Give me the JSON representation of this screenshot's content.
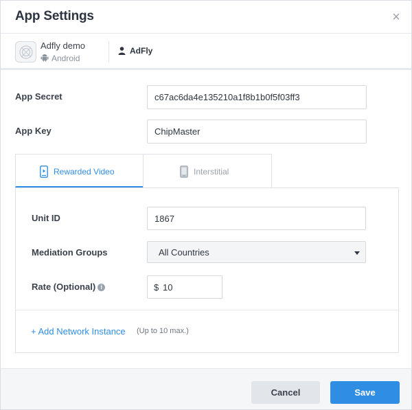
{
  "modal": {
    "title": "App Settings",
    "close_symbol": "×"
  },
  "app": {
    "name": "Adfly demo",
    "platform": "Android",
    "owner": "AdFly"
  },
  "fields": {
    "app_secret": {
      "label": "App Secret",
      "value": "c67ac6da4e135210a1f8b1b0f5f03ff3"
    },
    "app_key": {
      "label": "App Key",
      "value": "ChipMaster"
    }
  },
  "tabs": [
    {
      "label": "Rewarded Video",
      "active": true
    },
    {
      "label": "Interstitial",
      "active": false
    }
  ],
  "panel": {
    "unit_id": {
      "label": "Unit ID",
      "value": "1867"
    },
    "mediation": {
      "label": "Mediation Groups",
      "value": "All Countries"
    },
    "rate": {
      "label": "Rate (Optional)",
      "info_symbol": "i",
      "prefix": "$",
      "value": "10"
    },
    "add_link": "+ Add Network Instance",
    "add_note": "(Up to 10 max.)"
  },
  "buttons": {
    "cancel": "Cancel",
    "save": "Save"
  },
  "colors": {
    "accent": "#2f8de4",
    "footer_bg": "#f5f6f8"
  },
  "icons": [
    "close-icon",
    "app-placeholder-icon",
    "android-icon",
    "user-icon",
    "video-phone-icon",
    "phone-icon",
    "info-icon",
    "caret-down-icon"
  ]
}
